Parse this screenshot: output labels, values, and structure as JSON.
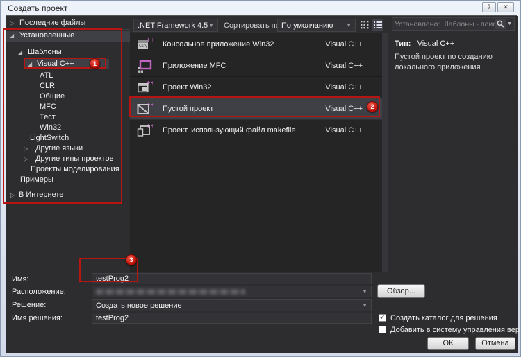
{
  "window": {
    "title": "Создать проект",
    "help_label": "?",
    "close_label": "✕"
  },
  "toolbar": {
    "framework_dropdown": ".NET Framework 4.5",
    "sort_label": "Сортировать по:",
    "sort_dropdown": "По умолчанию",
    "view_icons": [
      "grid-view-icon",
      "list-view-icon"
    ],
    "active_view": "list"
  },
  "search": {
    "placeholder": "Установлено: Шаблоны - поиск (Ctrl"
  },
  "sidebar": {
    "items": [
      {
        "label": "Последние файлы",
        "arrow": "collapsed"
      },
      {
        "label": "Установленные",
        "arrow": "expanded",
        "selected": true
      },
      {
        "label": "Шаблоны",
        "arrow": "expanded"
      },
      {
        "label": "Visual C++",
        "arrow": "expanded",
        "selected": true,
        "annotation": "1"
      },
      {
        "label": "ATL"
      },
      {
        "label": "CLR"
      },
      {
        "label": "Общие"
      },
      {
        "label": "MFC"
      },
      {
        "label": "Тест"
      },
      {
        "label": "Win32"
      },
      {
        "label": "LightSwitch"
      },
      {
        "label": "Другие языки",
        "arrow": "collapsed"
      },
      {
        "label": "Другие типы проектов",
        "arrow": "collapsed"
      },
      {
        "label": "Проекты моделирования"
      },
      {
        "label": "Примеры"
      },
      {
        "label": "В Интернете",
        "arrow": "collapsed"
      }
    ]
  },
  "templates": [
    {
      "name": "Консольное приложение Win32",
      "language": "Visual C++",
      "icon": "console-app-icon"
    },
    {
      "name": "Приложение MFC",
      "language": "Visual C++",
      "icon": "mfc-app-icon"
    },
    {
      "name": "Проект Win32",
      "language": "Visual C++",
      "icon": "win32-project-icon"
    },
    {
      "name": "Пустой проект",
      "language": "Visual C++",
      "icon": "empty-project-icon",
      "selected": true,
      "annotation": "2"
    },
    {
      "name": "Проект, использующий файл makefile",
      "language": "Visual C++",
      "icon": "makefile-project-icon"
    }
  ],
  "details": {
    "type_label": "Тип:",
    "type_value": "Visual C++",
    "description": "Пустой проект по созданию локального приложения"
  },
  "form": {
    "name_label": "Имя:",
    "name_value": "testProg2",
    "location_label": "Расположение:",
    "location_value_redacted": true,
    "solution_label": "Решение:",
    "solution_value": "Создать новое решение",
    "solution_name_label": "Имя решения:",
    "solution_name_value": "testProg2",
    "browse_button": "Обзор...",
    "checkbox_create_dir": {
      "label": "Создать каталог для решения",
      "checked": true
    },
    "checkbox_version_control": {
      "label": "Добавить в систему управления версиями",
      "checked": false
    },
    "ok_button": "ОК",
    "cancel_button": "Отмена"
  },
  "annotations": {
    "badge1": "1",
    "badge2": "2",
    "badge3": "3"
  },
  "colors": {
    "annotation_red": "#b71511",
    "badge_red": "#c8100a",
    "selection_bg": "#3f3f46",
    "accent_pink": "#c563c5",
    "list_bg": "#252526",
    "panel_bg": "#2d2d30",
    "frame_bg": "#dde3f0"
  }
}
